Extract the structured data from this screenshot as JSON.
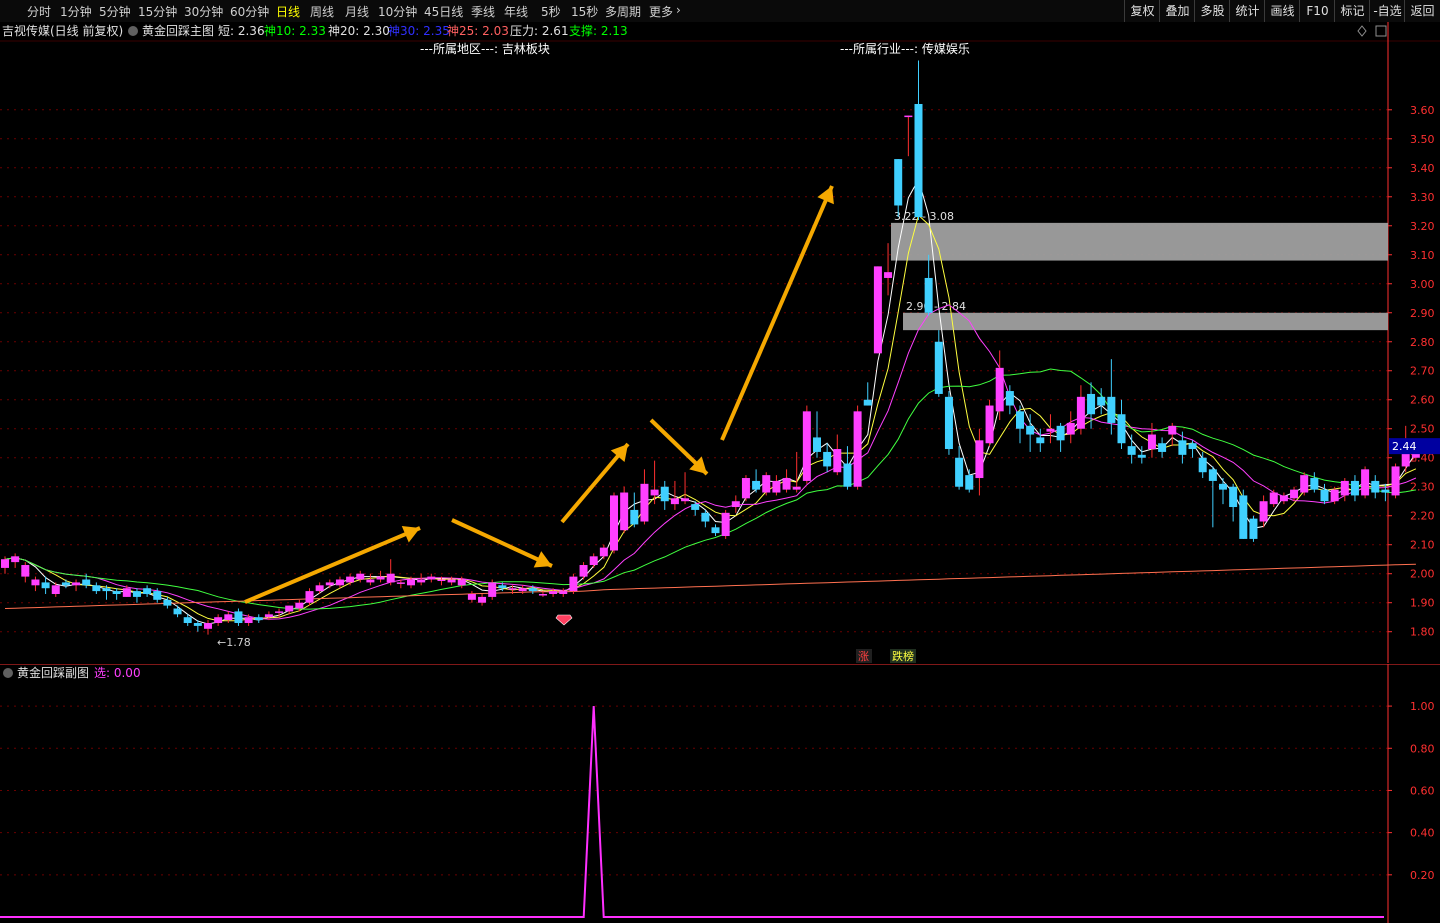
{
  "topbar": {
    "periods": [
      "分时",
      "1分钟",
      "5分钟",
      "15分钟",
      "30分钟",
      "60分钟",
      "日线",
      "周线",
      "月线",
      "10分钟",
      "45日线",
      "季线",
      "年线",
      "5秒",
      "15秒",
      "多周期",
      "更多"
    ],
    "active_period": "日线",
    "more_arrow": "›",
    "right_buttons": [
      "复权",
      "叠加",
      "多股",
      "统计",
      "画线",
      "F10",
      "标记",
      "-自选",
      "返回"
    ]
  },
  "main_header": {
    "stock_name": "吉视传媒(日线 前复权)",
    "indicator_name": "黄金回踩主图",
    "items": [
      {
        "label": "短:",
        "value": "2.36",
        "color": "#e0e0e0"
      },
      {
        "label": "神10:",
        "value": "2.33",
        "color": "#00ff00"
      },
      {
        "label": "神20:",
        "value": "2.30",
        "color": "#e0e0e0"
      },
      {
        "label": "神30:",
        "value": "2.35",
        "color": "#3030ff"
      },
      {
        "label": "神25:",
        "value": "2.03",
        "color": "#ff6060"
      },
      {
        "label": "压力:",
        "value": "2.61",
        "color": "#e0e0e0"
      },
      {
        "label": "支撑:",
        "value": "2.13",
        "color": "#00ff00"
      }
    ],
    "region_label": "---所属地区---: 吉林板块",
    "industry_label": "---所属行业---: 传媒娱乐",
    "top_marker": "3.77"
  },
  "chart_data": [
    {
      "type": "candlestick",
      "title": "黄金回踩主图",
      "y_axis_ticks": [
        "3.60",
        "3.50",
        "3.40",
        "3.30",
        "3.20",
        "3.10",
        "3.00",
        "2.90",
        "2.80",
        "2.70",
        "2.60",
        "2.50",
        "2.40",
        "2.30",
        "2.20",
        "2.10",
        "2.00",
        "1.90",
        "1.80"
      ],
      "ylim": [
        1.73,
        3.82
      ],
      "current_price": "2.44",
      "low_label": "1.78",
      "zones": [
        {
          "label": "3.22 - 3.08",
          "top": 3.21,
          "bottom": 3.08
        },
        {
          "label": "2.90 - 2.84",
          "top": 2.9,
          "bottom": 2.84
        }
      ],
      "candles": [
        [
          2.02,
          2.05,
          2.06,
          2.0
        ],
        [
          2.04,
          2.06,
          2.07,
          2.02
        ],
        [
          1.99,
          2.03,
          2.04,
          1.97
        ],
        [
          1.96,
          1.98,
          1.99,
          1.94
        ],
        [
          1.97,
          1.95,
          1.99,
          1.93
        ],
        [
          1.93,
          1.96,
          1.97,
          1.92
        ],
        [
          1.97,
          1.96,
          1.98,
          1.95
        ],
        [
          1.96,
          1.97,
          1.98,
          1.94
        ],
        [
          1.98,
          1.96,
          2.0,
          1.95
        ],
        [
          1.96,
          1.94,
          1.97,
          1.93
        ],
        [
          1.95,
          1.94,
          1.96,
          1.91
        ],
        [
          1.94,
          1.93,
          1.95,
          1.91
        ],
        [
          1.92,
          1.95,
          1.96,
          1.92
        ],
        [
          1.94,
          1.92,
          1.95,
          1.9
        ],
        [
          1.95,
          1.93,
          1.96,
          1.92
        ],
        [
          1.94,
          1.91,
          1.95,
          1.9
        ],
        [
          1.91,
          1.89,
          1.92,
          1.88
        ],
        [
          1.88,
          1.86,
          1.89,
          1.85
        ],
        [
          1.85,
          1.83,
          1.86,
          1.82
        ],
        [
          1.83,
          1.82,
          1.84,
          1.8
        ],
        [
          1.81,
          1.83,
          1.84,
          1.79
        ],
        [
          1.83,
          1.85,
          1.86,
          1.82
        ],
        [
          1.84,
          1.86,
          1.87,
          1.83
        ],
        [
          1.87,
          1.83,
          1.88,
          1.82
        ],
        [
          1.83,
          1.85,
          1.86,
          1.82
        ],
        [
          1.85,
          1.84,
          1.86,
          1.83
        ],
        [
          1.85,
          1.86,
          1.87,
          1.84
        ],
        [
          1.87,
          1.87,
          1.88,
          1.85
        ],
        [
          1.87,
          1.89,
          1.89,
          1.86
        ],
        [
          1.88,
          1.9,
          1.91,
          1.87
        ],
        [
          1.9,
          1.94,
          1.95,
          1.89
        ],
        [
          1.94,
          1.96,
          1.97,
          1.93
        ],
        [
          1.96,
          1.97,
          1.98,
          1.95
        ],
        [
          1.96,
          1.98,
          1.99,
          1.95
        ],
        [
          1.97,
          1.99,
          2.0,
          1.96
        ],
        [
          1.98,
          2.0,
          2.01,
          1.97
        ],
        [
          1.97,
          1.98,
          2.0,
          1.96
        ],
        [
          1.98,
          1.99,
          2.01,
          1.97
        ],
        [
          1.97,
          2.0,
          2.05,
          1.96
        ],
        [
          1.97,
          1.97,
          1.98,
          1.95
        ],
        [
          1.96,
          1.98,
          1.99,
          1.95
        ],
        [
          1.97,
          1.98,
          2.0,
          1.96
        ],
        [
          1.98,
          1.99,
          2.0,
          1.97
        ],
        [
          1.98,
          1.98,
          1.99,
          1.96
        ],
        [
          1.97,
          1.98,
          1.99,
          1.96
        ],
        [
          1.96,
          1.98,
          1.99,
          1.95
        ],
        [
          1.91,
          1.93,
          1.94,
          1.9
        ],
        [
          1.9,
          1.92,
          1.93,
          1.89
        ],
        [
          1.92,
          1.97,
          1.98,
          1.91
        ],
        [
          1.96,
          1.95,
          1.97,
          1.94
        ],
        [
          1.95,
          1.95,
          1.96,
          1.93
        ],
        [
          1.94,
          1.95,
          1.96,
          1.93
        ],
        [
          1.95,
          1.94,
          1.96,
          1.93
        ],
        [
          1.93,
          1.93,
          1.94,
          1.92
        ],
        [
          1.93,
          1.94,
          1.95,
          1.92
        ],
        [
          1.93,
          1.94,
          1.95,
          1.92
        ],
        [
          1.94,
          1.99,
          2.0,
          1.93
        ],
        [
          1.99,
          2.03,
          2.04,
          1.98
        ],
        [
          2.03,
          2.06,
          2.07,
          2.02
        ],
        [
          2.06,
          2.09,
          2.1,
          2.05
        ],
        [
          2.08,
          2.27,
          2.28,
          2.07
        ],
        [
          2.15,
          2.28,
          2.3,
          2.14
        ],
        [
          2.22,
          2.17,
          2.28,
          2.16
        ],
        [
          2.18,
          2.31,
          2.36,
          2.17
        ],
        [
          2.27,
          2.29,
          2.39,
          2.24
        ],
        [
          2.3,
          2.25,
          2.32,
          2.22
        ],
        [
          2.24,
          2.26,
          2.32,
          2.22
        ],
        [
          2.25,
          2.26,
          2.35,
          2.24
        ],
        [
          2.24,
          2.22,
          2.25,
          2.2
        ],
        [
          2.21,
          2.18,
          2.22,
          2.16
        ],
        [
          2.16,
          2.14,
          2.17,
          2.13
        ],
        [
          2.13,
          2.21,
          2.22,
          2.12
        ],
        [
          2.23,
          2.25,
          2.27,
          2.21
        ],
        [
          2.26,
          2.33,
          2.34,
          2.25
        ],
        [
          2.32,
          2.29,
          2.36,
          2.28
        ],
        [
          2.28,
          2.34,
          2.35,
          2.27
        ],
        [
          2.28,
          2.32,
          2.34,
          2.27
        ],
        [
          2.29,
          2.33,
          2.36,
          2.28
        ],
        [
          2.29,
          2.3,
          2.42,
          2.28
        ],
        [
          2.32,
          2.56,
          2.58,
          2.31
        ],
        [
          2.47,
          2.42,
          2.56,
          2.4
        ],
        [
          2.42,
          2.37,
          2.45,
          2.35
        ],
        [
          2.35,
          2.43,
          2.48,
          2.34
        ],
        [
          2.38,
          2.3,
          2.44,
          2.29
        ],
        [
          2.3,
          2.56,
          2.58,
          2.29
        ],
        [
          2.6,
          2.58,
          2.66,
          2.58
        ],
        [
          2.76,
          3.06,
          3.06,
          2.76
        ],
        [
          3.02,
          3.04,
          3.14,
          2.96
        ],
        [
          3.43,
          3.27,
          3.43,
          3.23
        ],
        [
          3.58,
          3.58,
          3.58,
          3.44
        ],
        [
          3.62,
          3.23,
          3.77,
          3.22
        ],
        [
          3.02,
          2.9,
          3.1,
          2.89
        ],
        [
          2.8,
          2.62,
          2.84,
          2.61
        ],
        [
          2.61,
          2.43,
          2.63,
          2.41
        ],
        [
          2.4,
          2.3,
          2.44,
          2.29
        ],
        [
          2.34,
          2.29,
          2.36,
          2.28
        ],
        [
          2.33,
          2.46,
          2.5,
          2.27
        ],
        [
          2.45,
          2.58,
          2.6,
          2.44
        ],
        [
          2.56,
          2.71,
          2.77,
          2.53
        ],
        [
          2.63,
          2.58,
          2.65,
          2.55
        ],
        [
          2.56,
          2.5,
          2.58,
          2.45
        ],
        [
          2.51,
          2.48,
          2.55,
          2.42
        ],
        [
          2.47,
          2.45,
          2.5,
          2.42
        ],
        [
          2.49,
          2.5,
          2.55,
          2.45
        ],
        [
          2.51,
          2.46,
          2.52,
          2.42
        ],
        [
          2.48,
          2.52,
          2.56,
          2.45
        ],
        [
          2.5,
          2.61,
          2.65,
          2.48
        ],
        [
          2.62,
          2.55,
          2.66,
          2.5
        ],
        [
          2.61,
          2.58,
          2.64,
          2.55
        ],
        [
          2.61,
          2.52,
          2.74,
          2.48
        ],
        [
          2.55,
          2.45,
          2.6,
          2.43
        ],
        [
          2.44,
          2.41,
          2.48,
          2.38
        ],
        [
          2.41,
          2.4,
          2.44,
          2.38
        ],
        [
          2.43,
          2.48,
          2.52,
          2.4
        ],
        [
          2.45,
          2.42,
          2.47,
          2.4
        ],
        [
          2.48,
          2.51,
          2.52,
          2.44
        ],
        [
          2.46,
          2.41,
          2.49,
          2.38
        ],
        [
          2.45,
          2.43,
          2.46,
          2.4
        ],
        [
          2.4,
          2.35,
          2.42,
          2.33
        ],
        [
          2.36,
          2.32,
          2.37,
          2.16
        ],
        [
          2.31,
          2.29,
          2.33,
          2.24
        ],
        [
          2.3,
          2.23,
          2.31,
          2.18
        ],
        [
          2.27,
          2.12,
          2.29,
          2.12
        ],
        [
          2.19,
          2.12,
          2.2,
          2.11
        ],
        [
          2.18,
          2.25,
          2.27,
          2.16
        ],
        [
          2.24,
          2.28,
          2.29,
          2.23
        ],
        [
          2.25,
          2.27,
          2.28,
          2.24
        ],
        [
          2.26,
          2.29,
          2.3,
          2.25
        ],
        [
          2.28,
          2.34,
          2.35,
          2.27
        ],
        [
          2.33,
          2.29,
          2.35,
          2.28
        ],
        [
          2.29,
          2.25,
          2.31,
          2.24
        ],
        [
          2.25,
          2.29,
          2.3,
          2.24
        ],
        [
          2.27,
          2.32,
          2.33,
          2.25
        ],
        [
          2.32,
          2.27,
          2.34,
          2.25
        ],
        [
          2.27,
          2.36,
          2.37,
          2.26
        ],
        [
          2.32,
          2.28,
          2.34,
          2.26
        ],
        [
          2.29,
          2.28,
          2.31,
          2.25
        ],
        [
          2.27,
          2.37,
          2.38,
          2.26
        ],
        [
          2.37,
          2.44,
          2.51,
          2.35
        ],
        [
          2.4,
          2.44,
          2.46,
          2.39
        ]
      ]
    },
    {
      "type": "line",
      "title": "黄金回踩副图",
      "series_label": "选:",
      "series_value": "0.00",
      "y_axis_ticks": [
        "1.00",
        "0.80",
        "0.60",
        "0.40",
        "0.20"
      ],
      "ylim": [
        0,
        1.1
      ],
      "spike_index": 58,
      "spike_value": 1.0
    }
  ],
  "markers": {
    "buy_signal_icon": "diamond-icon",
    "bottom_labels": [
      "涨",
      "跌榜"
    ]
  },
  "sub_header": {
    "indicator_name": "黄金回踩副图",
    "series_label": "选:",
    "series_value": "0.00"
  },
  "colors": {
    "up": "#ff40ff",
    "down": "#40d0ff",
    "grid": "#6a0000",
    "axis": "#ff3030",
    "arrow": "#f5a800",
    "zone": "#a0a0a0"
  }
}
